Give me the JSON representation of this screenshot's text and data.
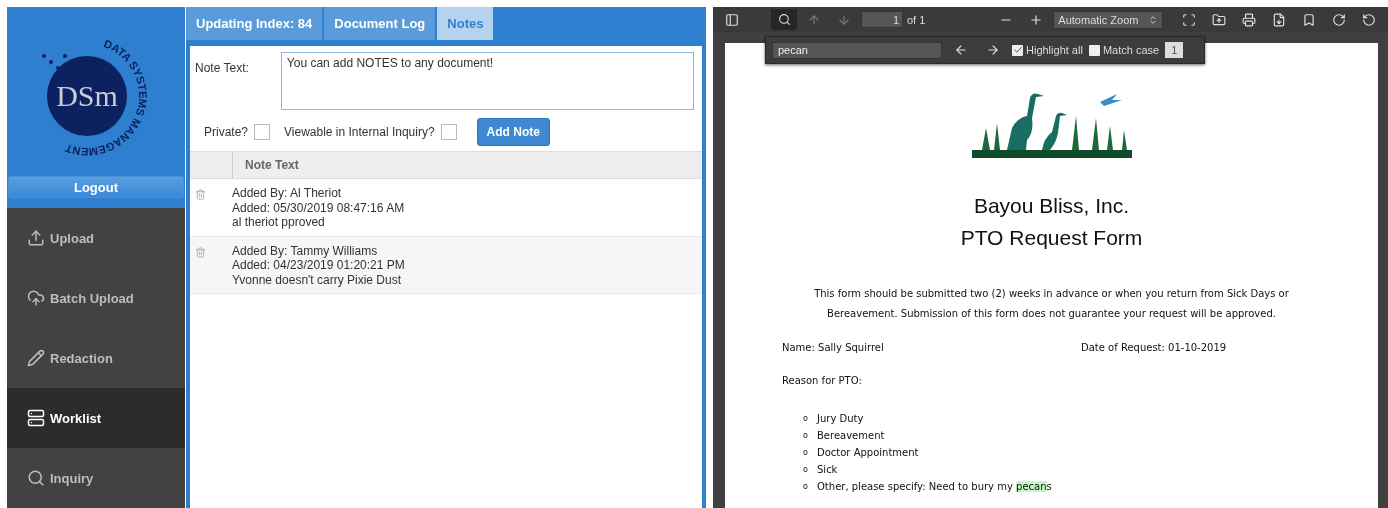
{
  "sidebar": {
    "logo": {
      "ring_text": "DATA SYSTEMS MANAGEMENT",
      "mark": "DSm"
    },
    "logout": "Logout",
    "items": [
      {
        "label": "Upload",
        "kind": "upload",
        "selected": false
      },
      {
        "label": "Batch Upload",
        "kind": "cloud",
        "selected": false
      },
      {
        "label": "Redaction",
        "kind": "pencil",
        "selected": false
      },
      {
        "label": "Worklist",
        "kind": "list",
        "selected": true
      },
      {
        "label": "Inquiry",
        "kind": "search",
        "selected": false
      }
    ]
  },
  "tabs": [
    {
      "label": "Updating Index: 84",
      "selected": false
    },
    {
      "label": "Document Log",
      "selected": false
    },
    {
      "label": "Notes",
      "selected": true
    }
  ],
  "note_form": {
    "label": "Note Text:",
    "value": "You can add NOTES to any document!",
    "private": {
      "label": "Private?",
      "checked": false
    },
    "viewable": {
      "label": "Viewable in Internal Inquiry?",
      "checked": false
    },
    "button": "Add Note"
  },
  "notes_table": {
    "columns": [
      "Note Text"
    ],
    "rows": [
      {
        "lines": [
          "Added By: Al Theriot",
          "Added: 05/30/2019 08:47:16 AM",
          "al theriot pproved"
        ]
      },
      {
        "lines": [
          "Added By: Tammy Williams",
          "Added: 04/23/2019 01:20:21 PM",
          "Yvonne doesn't carry Pixie Dust"
        ]
      }
    ]
  },
  "pdf_viewer": {
    "page": "1",
    "page_count": "of 1",
    "zoom": "Automatic Zoom",
    "find": {
      "query": "pecan",
      "highlight_all": {
        "label": "Highlight all",
        "checked": true
      },
      "match_case": {
        "label": "Match case",
        "checked": false
      },
      "count": "1"
    },
    "document": {
      "title_lines": [
        "Bayou Bliss, Inc.",
        "PTO Request Form"
      ],
      "intro_lines": [
        "This form should be submitted two (2) weeks in advance or when you return from Sick Days or",
        "Bereavement.  Submission of this form does not guarantee your request will be approved."
      ],
      "name": "Name: Sally Squirrel",
      "date": "Date of Request:  01-10-2019",
      "reason": "Reason for PTO:",
      "reasons": [
        {
          "bullet": "o",
          "text": "Jury Duty"
        },
        {
          "bullet": "o",
          "text": "Bereavement"
        },
        {
          "bullet": "o",
          "text": "Doctor Appointment"
        },
        {
          "bullet": "o",
          "text": "Sick"
        },
        {
          "bullet": "o",
          "text": "Other, please specify: Need to bury my ",
          "match": "pecan",
          "rest": "s"
        }
      ]
    }
  }
}
